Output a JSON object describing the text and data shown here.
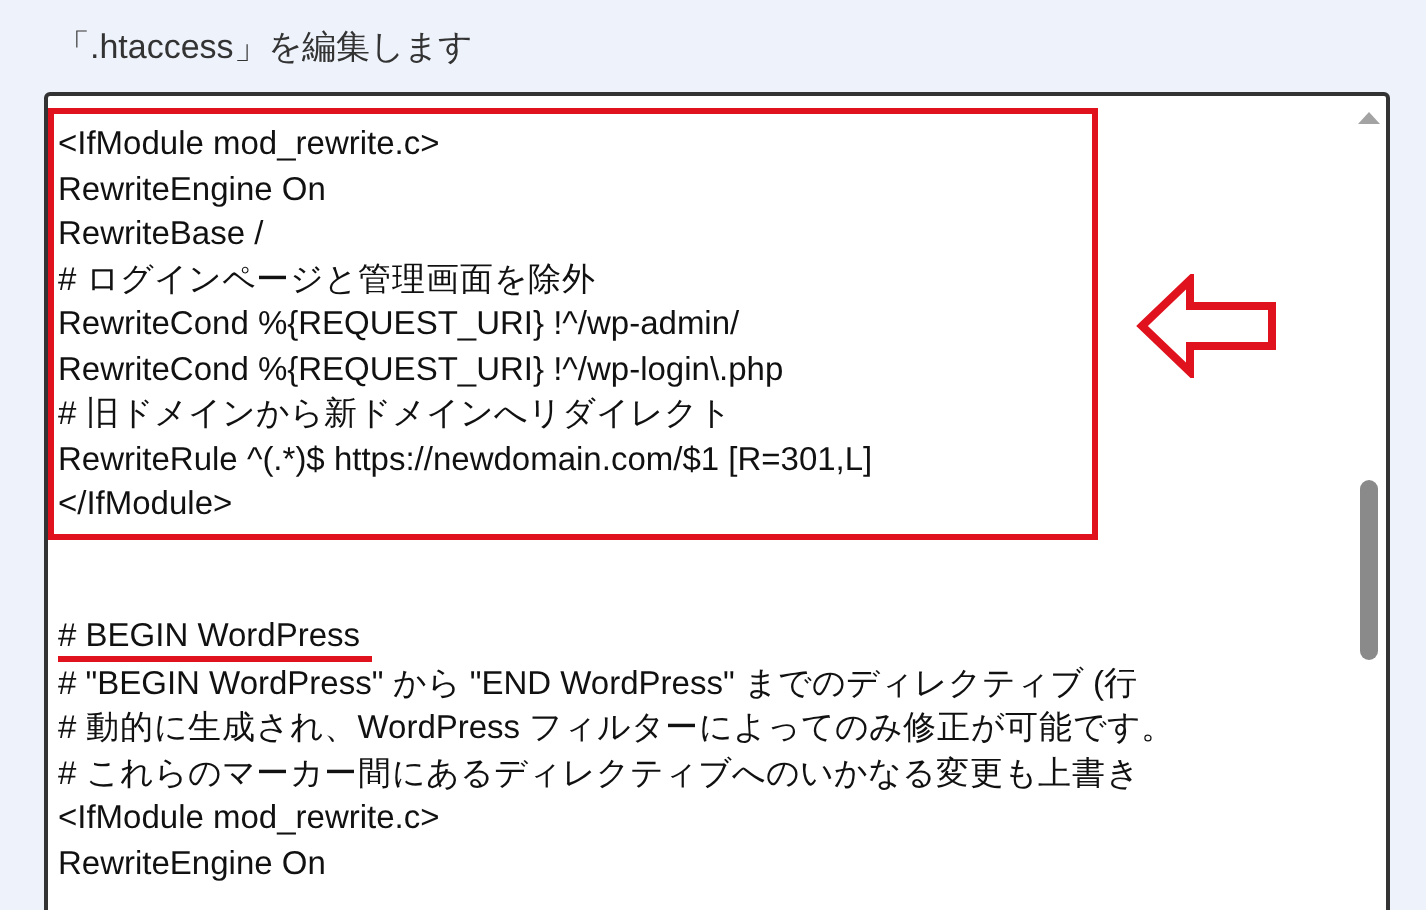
{
  "title": "「.htaccess」を編集します",
  "editor": {
    "highlighted_block": [
      "<IfModule mod_rewrite.c>",
      "RewriteEngine On",
      "RewriteBase /",
      "# ログインページと管理画面を除外",
      "RewriteCond %{REQUEST_URI} !^/wp-admin/",
      "RewriteCond %{REQUEST_URI} !^/wp-login\\.php",
      "# 旧ドメインから新ドメインへリダイレクト",
      "RewriteRule ^(.*)$ https://newdomain.com/$1 [R=301,L]",
      "</IfModule>"
    ],
    "lines": [
      {
        "text": "# BEGIN WordPress",
        "underlined": true
      },
      {
        "text": "# \"BEGIN WordPress\" から \"END WordPress\" までのディレクティブ (行",
        "underlined": false
      },
      {
        "text": "# 動的に生成され、WordPress フィルターによってのみ修正が可能です。",
        "underlined": false
      },
      {
        "text": "# これらのマーカー間にあるディレクティブへのいかなる変更も上書き",
        "underlined": false
      },
      {
        "text": "<IfModule mod_rewrite.c>",
        "underlined": false
      },
      {
        "text": "RewriteEngine On",
        "underlined": false
      }
    ]
  }
}
